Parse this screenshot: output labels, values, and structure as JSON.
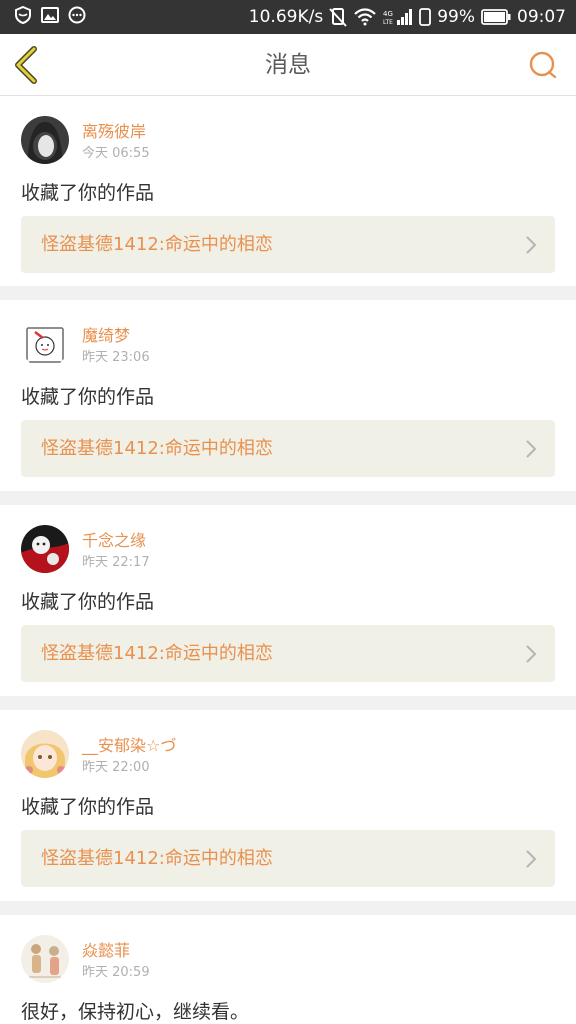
{
  "status_bar": {
    "network_speed": "10.69K/s",
    "network_type": "4G",
    "battery": "99%",
    "time": "09:07",
    "icons": [
      "shield-icon",
      "image-icon",
      "message-icon",
      "mute-icon",
      "wifi-icon",
      "signal-icon",
      "battery-icon"
    ]
  },
  "header": {
    "title": "消息",
    "back_icon": "chevron-left-icon",
    "search_icon": "search-icon",
    "accent_color": "#e8914f"
  },
  "messages": [
    {
      "user": "离殇彼岸",
      "time": "今天 06:55",
      "action": "收藏了你的作品",
      "work": "怪盗基德1412:命运中的相恋"
    },
    {
      "user": "魔绮梦",
      "time": "昨天 23:06",
      "action": "收藏了你的作品",
      "work": "怪盗基德1412:命运中的相恋"
    },
    {
      "user": "千念之缘",
      "time": "昨天 22:17",
      "action": "收藏了你的作品",
      "work": "怪盗基德1412:命运中的相恋"
    },
    {
      "user": "__安郁染☆づ",
      "time": "昨天 22:00",
      "action": "收藏了你的作品",
      "work": "怪盗基德1412:命运中的相恋"
    },
    {
      "user": "焱懿菲",
      "time": "昨天 20:59",
      "action": "很好，保持初心，继续看。"
    }
  ]
}
